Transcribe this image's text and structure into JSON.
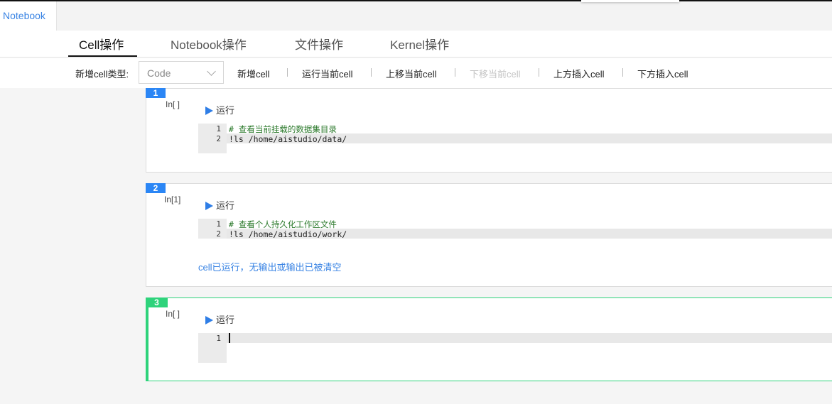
{
  "tabbar": {
    "notebook_tab": "Notebook"
  },
  "op_tabs": [
    {
      "label": "Cell操作"
    },
    {
      "label": "Notebook操作"
    },
    {
      "label": "文件操作"
    },
    {
      "label": "Kernel操作"
    }
  ],
  "toolbar": {
    "cell_type_label": "新增cell类型:",
    "cell_type_value": "Code",
    "buttons": [
      {
        "label": "新增cell",
        "enabled": true
      },
      {
        "label": "运行当前cell",
        "enabled": true
      },
      {
        "label": "上移当前cell",
        "enabled": true
      },
      {
        "label": "下移当前cell",
        "enabled": false
      },
      {
        "label": "上方插入cell",
        "enabled": true
      },
      {
        "label": "下方插入cell",
        "enabled": true
      }
    ]
  },
  "cells": [
    {
      "number": "1",
      "prompt": "In[ ]",
      "run_label": "运行",
      "lines": [
        {
          "n": "1",
          "text": "# 查看当前挂载的数据集目录"
        },
        {
          "n": "2",
          "text": "!ls /home/aistudio/data/"
        }
      ],
      "output": ""
    },
    {
      "number": "2",
      "prompt": "In[1]",
      "run_label": "运行",
      "lines": [
        {
          "n": "1",
          "text": "# 查看个人持久化工作区文件"
        },
        {
          "n": "2",
          "text": "!ls /home/aistudio/work/"
        }
      ],
      "output": "cell已运行，无输出或输出已被清空"
    },
    {
      "number": "3",
      "prompt": "In[ ]",
      "run_label": "运行",
      "lines": [
        {
          "n": "1",
          "text": ""
        }
      ],
      "output": "",
      "selected": true
    }
  ],
  "colors": {
    "accent_blue": "#2b86f5",
    "selected_green": "#2ed37b",
    "output_blue": "#3a84e4"
  }
}
